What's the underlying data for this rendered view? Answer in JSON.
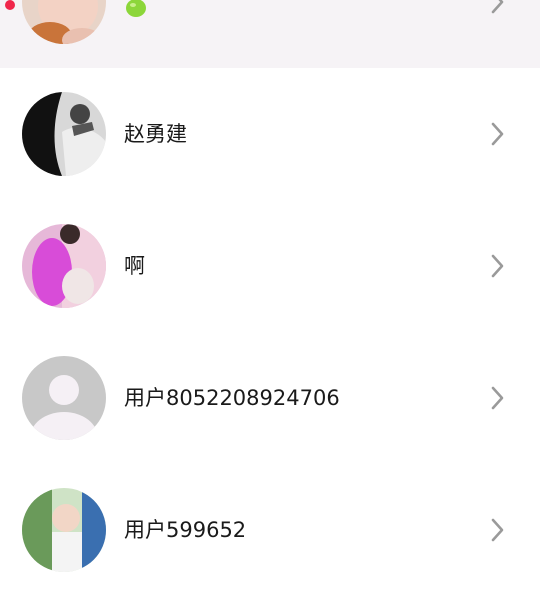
{
  "contacts": [
    {
      "name": "",
      "avatar_icon": "baby-photo-avatar",
      "status_icon": "green-apple-emoji",
      "unread": true
    },
    {
      "name": "赵勇建",
      "avatar_icon": "bw-photo-avatar"
    },
    {
      "name": "啊",
      "avatar_icon": "pink-photo-avatar"
    },
    {
      "name": "用户8052208924706",
      "avatar_icon": "default-user-avatar"
    },
    {
      "name": "用户599652",
      "avatar_icon": "child-photo-avatar"
    }
  ],
  "icons": {
    "row_action": "chevron-right-icon"
  },
  "colors": {
    "highlight_row_bg": "#f6f3f6",
    "unread_dot": "#f0264b",
    "chevron": "#9a9a9a",
    "default_avatar_bg": "#c8c8c8"
  }
}
